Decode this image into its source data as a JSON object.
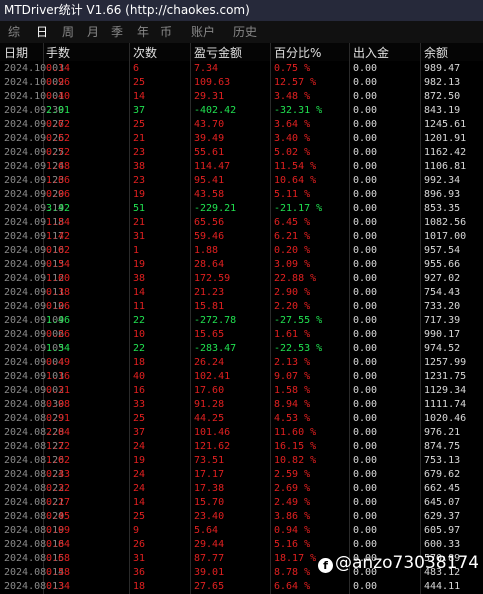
{
  "app": {
    "title": "MTDriver统计 V1.66  (http://chaokes.com)",
    "tabs": [
      {
        "label": "综",
        "active": false
      },
      {
        "label": "日",
        "active": true
      },
      {
        "label": "周",
        "active": false
      },
      {
        "label": "月",
        "active": false
      },
      {
        "label": "季",
        "active": false
      },
      {
        "label": "年",
        "active": false
      },
      {
        "label": "币",
        "active": false
      },
      {
        "label": "账户",
        "active": false
      },
      {
        "label": "历史",
        "active": false
      }
    ]
  },
  "table": {
    "columns": [
      "日期",
      "手数",
      "次数",
      "盈亏金额",
      "百分比%",
      "出入金",
      "余额"
    ],
    "rows": [
      {
        "date": "2024.10.03",
        "lots": "0.14",
        "trades": "6",
        "pnl": "7.34",
        "pct": "0.75 %",
        "flow": "0.00",
        "balance": "989.47",
        "sign": "pos"
      },
      {
        "date": "2024.10.02",
        "lots": "0.96",
        "trades": "25",
        "pnl": "109.63",
        "pct": "12.57 %",
        "flow": "0.00",
        "balance": "982.13",
        "sign": "pos"
      },
      {
        "date": "2024.10.01",
        "lots": "0.40",
        "trades": "14",
        "pnl": "29.31",
        "pct": "3.48 %",
        "flow": "0.00",
        "balance": "872.50",
        "sign": "pos"
      },
      {
        "date": "2024.09.30",
        "lots": "2.91",
        "trades": "37",
        "pnl": "-402.42",
        "pct": "-32.31 %",
        "flow": "0.00",
        "balance": "843.19",
        "sign": "neg"
      },
      {
        "date": "2024.09.27",
        "lots": "0.62",
        "trades": "25",
        "pnl": "43.70",
        "pct": "3.64 %",
        "flow": "0.00",
        "balance": "1245.61",
        "sign": "pos"
      },
      {
        "date": "2024.09.26",
        "lots": "0.52",
        "trades": "21",
        "pnl": "39.49",
        "pct": "3.40 %",
        "flow": "0.00",
        "balance": "1201.91",
        "sign": "pos"
      },
      {
        "date": "2024.09.25",
        "lots": "0.72",
        "trades": "23",
        "pnl": "55.61",
        "pct": "5.02 %",
        "flow": "0.00",
        "balance": "1162.42",
        "sign": "pos"
      },
      {
        "date": "2024.09.24",
        "lots": "1.68",
        "trades": "38",
        "pnl": "114.47",
        "pct": "11.54 %",
        "flow": "0.00",
        "balance": "1106.81",
        "sign": "pos"
      },
      {
        "date": "2024.09.23",
        "lots": "1.66",
        "trades": "23",
        "pnl": "95.41",
        "pct": "10.64 %",
        "flow": "0.00",
        "balance": "992.34",
        "sign": "pos"
      },
      {
        "date": "2024.09.20",
        "lots": "0.96",
        "trades": "19",
        "pnl": "43.58",
        "pct": "5.11 %",
        "flow": "0.00",
        "balance": "896.93",
        "sign": "pos"
      },
      {
        "date": "2024.09.19",
        "lots": "3.42",
        "trades": "51",
        "pnl": "-229.21",
        "pct": "-21.17 %",
        "flow": "0.00",
        "balance": "853.35",
        "sign": "neg"
      },
      {
        "date": "2024.09.18",
        "lots": "1.54",
        "trades": "21",
        "pnl": "65.56",
        "pct": "6.45 %",
        "flow": "0.00",
        "balance": "1082.56",
        "sign": "pos"
      },
      {
        "date": "2024.09.17",
        "lots": "1.42",
        "trades": "31",
        "pnl": "59.46",
        "pct": "6.21 %",
        "flow": "0.00",
        "balance": "1017.00",
        "sign": "pos"
      },
      {
        "date": "2024.09.16",
        "lots": "0.02",
        "trades": "1",
        "pnl": "1.88",
        "pct": "0.20 %",
        "flow": "0.00",
        "balance": "957.54",
        "sign": "pos"
      },
      {
        "date": "2024.09.13",
        "lots": "0.54",
        "trades": "19",
        "pnl": "28.64",
        "pct": "3.09 %",
        "flow": "0.00",
        "balance": "955.66",
        "sign": "pos"
      },
      {
        "date": "2024.09.12",
        "lots": "1.60",
        "trades": "38",
        "pnl": "172.59",
        "pct": "22.88 %",
        "flow": "0.00",
        "balance": "927.02",
        "sign": "pos"
      },
      {
        "date": "2024.09.11",
        "lots": "0.38",
        "trades": "14",
        "pnl": "21.23",
        "pct": "2.90 %",
        "flow": "0.00",
        "balance": "754.43",
        "sign": "pos"
      },
      {
        "date": "2024.09.10",
        "lots": "0.26",
        "trades": "11",
        "pnl": "15.81",
        "pct": "2.20 %",
        "flow": "0.00",
        "balance": "733.20",
        "sign": "pos"
      },
      {
        "date": "2024.09.09",
        "lots": "1.46",
        "trades": "22",
        "pnl": "-272.78",
        "pct": "-27.55 %",
        "flow": "0.00",
        "balance": "717.39",
        "sign": "neg"
      },
      {
        "date": "2024.09.06",
        "lots": "0.26",
        "trades": "10",
        "pnl": "15.65",
        "pct": "1.61 %",
        "flow": "0.00",
        "balance": "990.17",
        "sign": "pos"
      },
      {
        "date": "2024.09.05",
        "lots": "1.34",
        "trades": "22",
        "pnl": "-283.47",
        "pct": "-22.53 %",
        "flow": "0.00",
        "balance": "974.52",
        "sign": "neg"
      },
      {
        "date": "2024.09.04",
        "lots": "0.49",
        "trades": "18",
        "pnl": "26.24",
        "pct": "2.13 %",
        "flow": "0.00",
        "balance": "1257.99",
        "sign": "pos"
      },
      {
        "date": "2024.09.03",
        "lots": "1.16",
        "trades": "40",
        "pnl": "102.41",
        "pct": "9.07 %",
        "flow": "0.00",
        "balance": "1231.75",
        "sign": "pos"
      },
      {
        "date": "2024.09.02",
        "lots": "0.31",
        "trades": "16",
        "pnl": "17.60",
        "pct": "1.58 %",
        "flow": "0.00",
        "balance": "1129.34",
        "sign": "pos"
      },
      {
        "date": "2024.08.30",
        "lots": "0.98",
        "trades": "33",
        "pnl": "91.28",
        "pct": "8.94 %",
        "flow": "0.00",
        "balance": "1111.74",
        "sign": "pos"
      },
      {
        "date": "2024.08.29",
        "lots": "0.91",
        "trades": "25",
        "pnl": "44.25",
        "pct": "4.53 %",
        "flow": "0.00",
        "balance": "1020.46",
        "sign": "pos"
      },
      {
        "date": "2024.08.28",
        "lots": "2.04",
        "trades": "37",
        "pnl": "101.46",
        "pct": "11.60 %",
        "flow": "0.00",
        "balance": "976.21",
        "sign": "pos"
      },
      {
        "date": "2024.08.27",
        "lots": "1.22",
        "trades": "24",
        "pnl": "121.62",
        "pct": "16.15 %",
        "flow": "0.00",
        "balance": "874.75",
        "sign": "pos"
      },
      {
        "date": "2024.08.26",
        "lots": "1.02",
        "trades": "19",
        "pnl": "73.51",
        "pct": "10.82 %",
        "flow": "0.00",
        "balance": "753.13",
        "sign": "pos"
      },
      {
        "date": "2024.08.23",
        "lots": "0.43",
        "trades": "24",
        "pnl": "17.17",
        "pct": "2.59 %",
        "flow": "0.00",
        "balance": "679.62",
        "sign": "pos"
      },
      {
        "date": "2024.08.22",
        "lots": "0.32",
        "trades": "24",
        "pnl": "17.38",
        "pct": "2.69 %",
        "flow": "0.00",
        "balance": "662.45",
        "sign": "pos"
      },
      {
        "date": "2024.08.21",
        "lots": "0.27",
        "trades": "14",
        "pnl": "15.70",
        "pct": "2.49 %",
        "flow": "0.00",
        "balance": "645.07",
        "sign": "pos"
      },
      {
        "date": "2024.08.20",
        "lots": "0.45",
        "trades": "25",
        "pnl": "23.40",
        "pct": "3.86 %",
        "flow": "0.00",
        "balance": "629.37",
        "sign": "pos"
      },
      {
        "date": "2024.08.19",
        "lots": "0.09",
        "trades": "9",
        "pnl": "5.64",
        "pct": "0.94 %",
        "flow": "0.00",
        "balance": "605.97",
        "sign": "pos"
      },
      {
        "date": "2024.08.16",
        "lots": "0.84",
        "trades": "26",
        "pnl": "29.44",
        "pct": "5.16 %",
        "flow": "0.00",
        "balance": "600.33",
        "sign": "pos"
      },
      {
        "date": "2024.08.15",
        "lots": "0.68",
        "trades": "31",
        "pnl": "87.77",
        "pct": "18.17 %",
        "flow": "0.00",
        "balance": "570.89",
        "sign": "pos"
      },
      {
        "date": "2024.08.14",
        "lots": "0.58",
        "trades": "36",
        "pnl": "39.01",
        "pct": "8.78 %",
        "flow": "0.00",
        "balance": "483.12",
        "sign": "pos"
      },
      {
        "date": "2024.08.13",
        "lots": "0.34",
        "trades": "18",
        "pnl": "27.65",
        "pct": "6.64 %",
        "flow": "0.00",
        "balance": "444.11",
        "sign": "pos"
      }
    ]
  },
  "watermark": {
    "icon": "f",
    "text": "@anzo7303817410"
  }
}
